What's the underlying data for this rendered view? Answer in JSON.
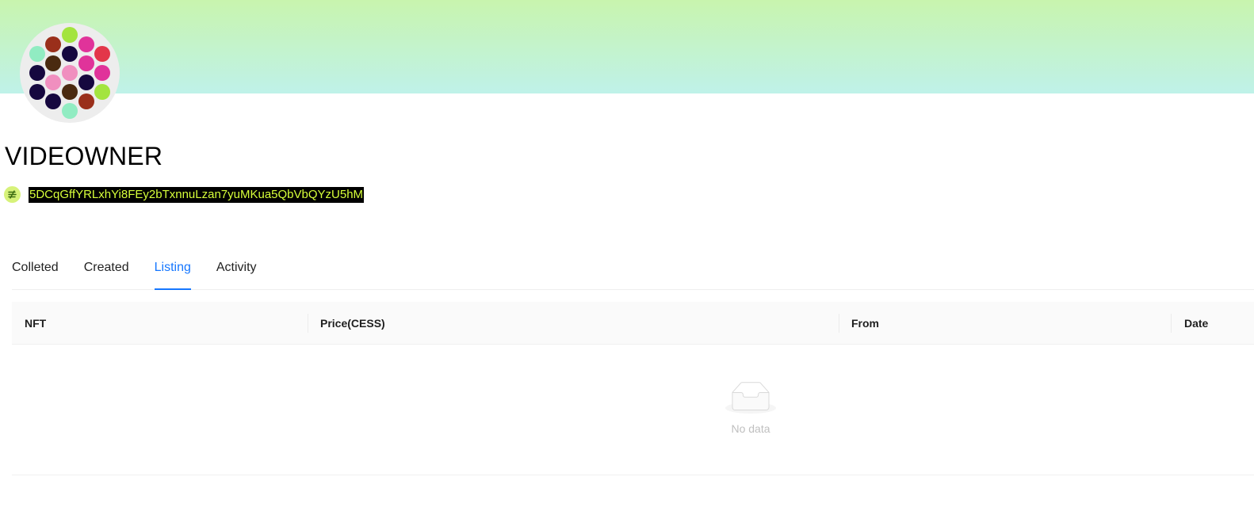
{
  "profile": {
    "name": "VIDEOWNER",
    "address": "5DCqGffYRLxhYi8FEy2bTxnnuLzan7yuMKua5QbVbQYzU5hM",
    "avatar_icon": "identicon-avatar",
    "chain_icon": "cess-chain-icon"
  },
  "colors": {
    "accent": "#1677ff",
    "banner_top": "#c8f4ae",
    "banner_bottom": "#bff2e9",
    "address_highlight_bg": "#000000",
    "address_highlight_fg": "#d7ff3a"
  },
  "tabs": [
    {
      "label": "Colleted",
      "active": false
    },
    {
      "label": "Created",
      "active": false
    },
    {
      "label": "Listing",
      "active": true
    },
    {
      "label": "Activity",
      "active": false
    }
  ],
  "table": {
    "columns": [
      "NFT",
      "Price(CESS)",
      "From",
      "Date"
    ],
    "empty_text": "No data",
    "empty_icon": "empty-inbox-icon"
  }
}
